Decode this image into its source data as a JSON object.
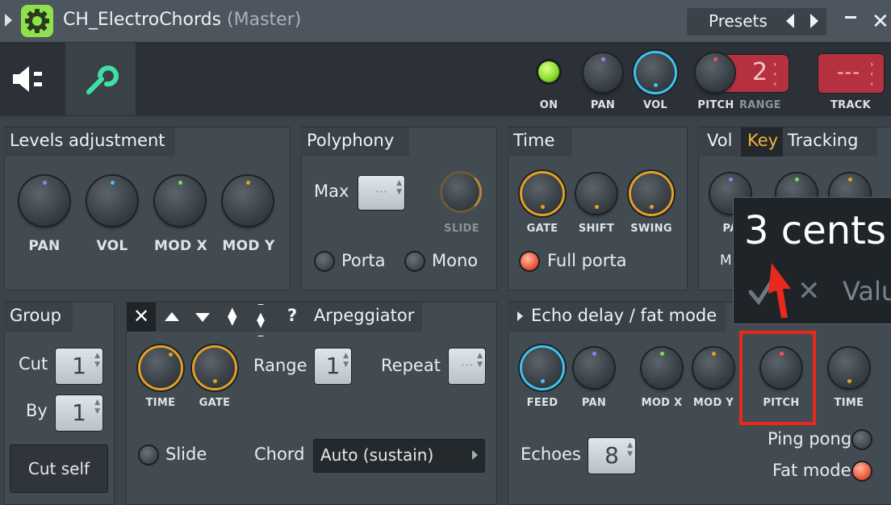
{
  "title": {
    "name": "CH_ElectroChords",
    "suffix": "(Master)"
  },
  "presets": {
    "label": "Presets"
  },
  "toolbar": {
    "on": "ON",
    "pan": "PAN",
    "vol": "VOL",
    "pitch": "PITCH",
    "range": "RANGE",
    "range_value": "2",
    "track": "TRACK",
    "track_value": "---"
  },
  "levels": {
    "title": "Levels adjustment",
    "knobs": [
      "PAN",
      "VOL",
      "MOD X",
      "MOD Y"
    ]
  },
  "polyphony": {
    "title": "Polyphony",
    "max": "Max",
    "max_value": "···",
    "slide": "SLIDE",
    "porta": "Porta",
    "mono": "Mono"
  },
  "time": {
    "title": "Time",
    "knobs": [
      "GATE",
      "SHIFT",
      "SWING"
    ],
    "full_porta": "Full porta"
  },
  "tracking": {
    "tab_vol": "Vol",
    "tab_key": "Key",
    "label": "Tracking",
    "pan_partial": "PA",
    "mod_partial": "M"
  },
  "group": {
    "title": "Group",
    "cut": "Cut",
    "cut_value": "1",
    "by": "By",
    "by_value": "1",
    "cut_self": "Cut self"
  },
  "arp": {
    "title": "Arpeggiator",
    "time": "TIME",
    "gate": "GATE",
    "range": "Range",
    "range_value": "1",
    "repeat": "Repeat",
    "repeat_value": "···",
    "slide": "Slide",
    "chord": "Chord",
    "chord_value": "Auto (sustain)",
    "help": "?"
  },
  "echo": {
    "title": "Echo delay / fat mode",
    "knobs": [
      "FEED",
      "PAN",
      "MOD X",
      "MOD Y",
      "PITCH",
      "TIME"
    ],
    "echoes": "Echoes",
    "echoes_value": "8",
    "ping_pong": "Ping pong",
    "fat_mode": "Fat mode"
  },
  "tooltip": {
    "value": "3 cents",
    "partial": "Valu"
  },
  "colors": {
    "accent_orange": "#e3a124",
    "accent_cyan": "#3fc3f0",
    "highlight": "#e8291b",
    "led_green": "#8be02a",
    "key_tab": "#f2b233"
  }
}
